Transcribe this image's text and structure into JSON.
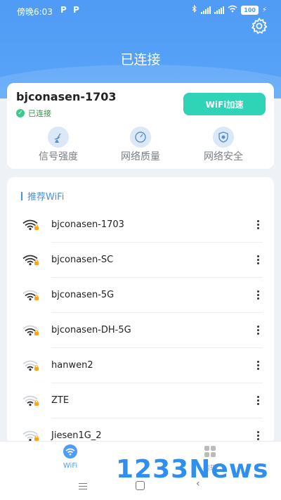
{
  "status_bar": {
    "time": "傍晚6:03",
    "p1": "P",
    "p2": "P",
    "battery": "100"
  },
  "header": {
    "title": "已连接"
  },
  "connected": {
    "ssid": "bjconasen-1703",
    "status": "已连接",
    "speed_button": "WiFi加速",
    "features": [
      {
        "label": "信号强度",
        "icon": "satellite-dish-icon"
      },
      {
        "label": "网络质量",
        "icon": "speedometer-icon"
      },
      {
        "label": "网络安全",
        "icon": "shield-icon"
      }
    ]
  },
  "recommend": {
    "title": "推荐WiFi",
    "networks": [
      {
        "name": "bjconasen-1703",
        "signal": 4
      },
      {
        "name": "bjconasen-SC",
        "signal": 4
      },
      {
        "name": "bjconasen-5G",
        "signal": 3
      },
      {
        "name": "bjconasen-DH-5G",
        "signal": 3
      },
      {
        "name": "hanwen2",
        "signal": 2
      },
      {
        "name": "ZTE",
        "signal": 2
      },
      {
        "name": "Jiesen1G_2",
        "signal": 1
      }
    ]
  },
  "tabs": [
    {
      "label": "WiFi",
      "icon": "wifi-icon",
      "active": true
    },
    {
      "label": "清理",
      "icon": "grid-icon",
      "active": false
    }
  ],
  "watermark": "1233News",
  "colors": {
    "primary": "#4f9bf5",
    "accent": "#2fd4b6",
    "success": "#3cc98f",
    "lock": "#f5a623"
  }
}
